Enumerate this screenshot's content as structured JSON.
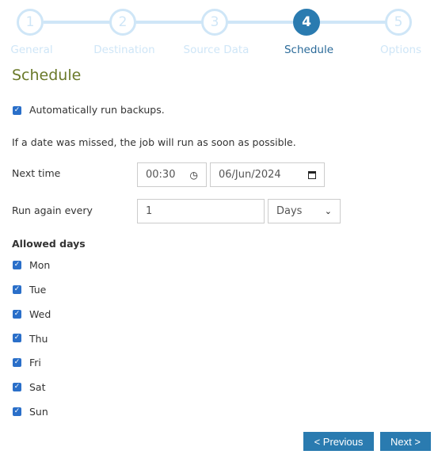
{
  "steps": [
    {
      "num": "1",
      "label": "General"
    },
    {
      "num": "2",
      "label": "Destination"
    },
    {
      "num": "3",
      "label": "Source Data"
    },
    {
      "num": "4",
      "label": "Schedule",
      "active": true
    },
    {
      "num": "5",
      "label": "Options"
    }
  ],
  "title": "Schedule",
  "auto_run": {
    "label": "Automatically run backups.",
    "checked": true
  },
  "missed_note": "If a date was missed, the job will run as soon as possible.",
  "next_time": {
    "label": "Next time",
    "time": "00:30",
    "date": "06/Jun/2024"
  },
  "run_again": {
    "label": "Run again every",
    "value": "1",
    "unit": "Days"
  },
  "allowed_days": {
    "label": "Allowed days",
    "days": [
      {
        "label": "Mon",
        "checked": true
      },
      {
        "label": "Tue",
        "checked": true
      },
      {
        "label": "Wed",
        "checked": true
      },
      {
        "label": "Thu",
        "checked": true
      },
      {
        "label": "Fri",
        "checked": true
      },
      {
        "label": "Sat",
        "checked": true
      },
      {
        "label": "Sun",
        "checked": true
      }
    ]
  },
  "buttons": {
    "previous": "< Previous",
    "next": "Next >"
  }
}
